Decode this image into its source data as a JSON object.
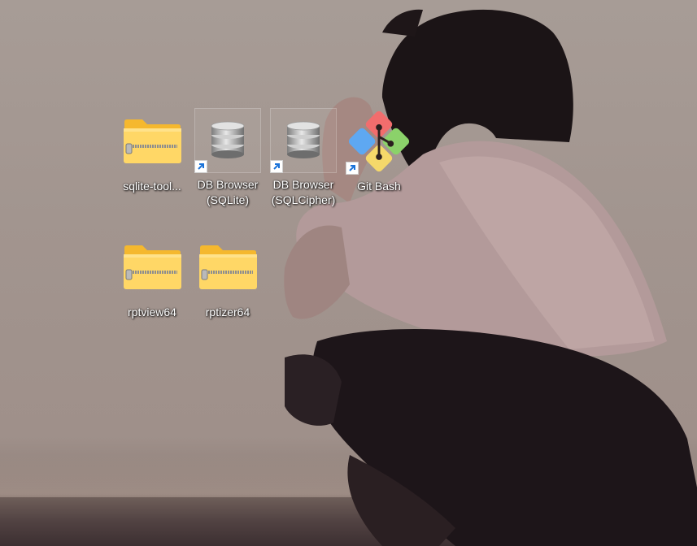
{
  "desktop": {
    "icons": [
      {
        "label": "sqlite-tool...",
        "icon": "zip-folder-icon",
        "shortcut": false
      },
      {
        "label": "DB Browser (SQLite)",
        "icon": "database-icon",
        "shortcut": true
      },
      {
        "label": "DB Browser (SQLCipher)",
        "icon": "database-icon",
        "shortcut": true
      },
      {
        "label": "Git Bash",
        "icon": "git-icon",
        "shortcut": true
      },
      {
        "label": "rptview64",
        "icon": "zip-folder-icon",
        "shortcut": false
      },
      {
        "label": "rptizer64",
        "icon": "zip-folder-icon",
        "shortcut": false
      }
    ],
    "colors": {
      "folder_front": "#ffd766",
      "folder_back": "#f5b82e",
      "git_red": "#f26d6d",
      "git_blue": "#5ea8f2",
      "git_green": "#8bd26a",
      "git_yellow": "#f5d86a",
      "shortcut_arrow": "#1a73d9"
    }
  }
}
